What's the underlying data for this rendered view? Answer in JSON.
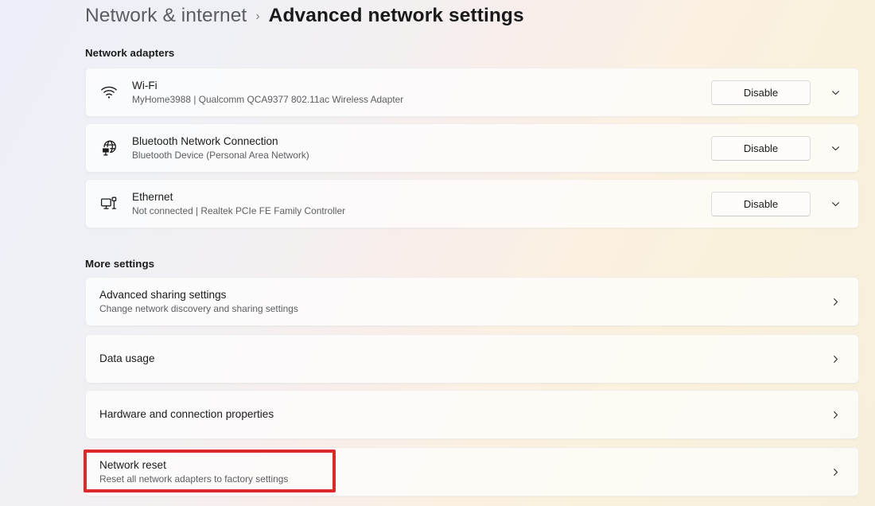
{
  "breadcrumb": {
    "parent": "Network & internet",
    "separator": "›",
    "current": "Advanced network settings"
  },
  "sections": {
    "adapters_title": "Network adapters",
    "more_title": "More settings"
  },
  "adapters": [
    {
      "icon": "wifi-icon",
      "name": "Wi-Fi",
      "description": "MyHome3988 | Qualcomm QCA9377 802.11ac Wireless Adapter",
      "action_label": "Disable",
      "expander": "chevron-down-icon"
    },
    {
      "icon": "bluetooth-network-icon",
      "name": "Bluetooth Network Connection",
      "description": "Bluetooth Device (Personal Area Network)",
      "action_label": "Disable",
      "expander": "chevron-down-icon"
    },
    {
      "icon": "ethernet-icon",
      "name": "Ethernet",
      "description": "Not connected | Realtek PCIe FE Family Controller",
      "action_label": "Disable",
      "expander": "chevron-down-icon"
    }
  ],
  "more_settings": [
    {
      "name": "Advanced sharing settings",
      "description": "Change network discovery and sharing settings",
      "chevron": "chevron-right-icon",
      "highlighted": false
    },
    {
      "name": "Data usage",
      "description": "",
      "chevron": "chevron-right-icon",
      "highlighted": false
    },
    {
      "name": "Hardware and connection properties",
      "description": "",
      "chevron": "chevron-right-icon",
      "highlighted": false
    },
    {
      "name": "Network reset",
      "description": "Reset all network adapters to factory settings",
      "chevron": "chevron-right-icon",
      "highlighted": true
    }
  ],
  "annotation": {
    "color": "#dc2828",
    "target": "Network reset"
  }
}
